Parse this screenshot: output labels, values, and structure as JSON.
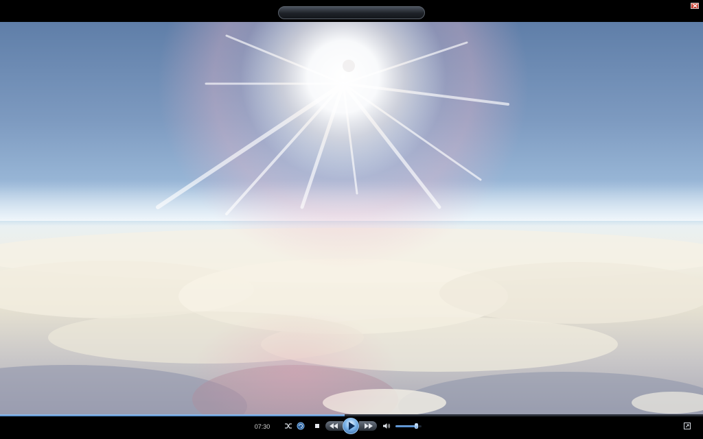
{
  "player": {
    "time_elapsed": "07:30",
    "seek_progress": 0.49,
    "volume_level": 0.82
  },
  "colors": {
    "accent": "#4a86c8",
    "background": "#000000"
  },
  "icons": {
    "close": "close-icon",
    "shuffle": "shuffle-icon",
    "repeat": "repeat-icon",
    "stop": "stop-icon",
    "previous": "rewind-icon",
    "play": "play-icon",
    "next": "fast-forward-icon",
    "volume": "speaker-icon",
    "fullscreen": "fullscreen-icon"
  }
}
